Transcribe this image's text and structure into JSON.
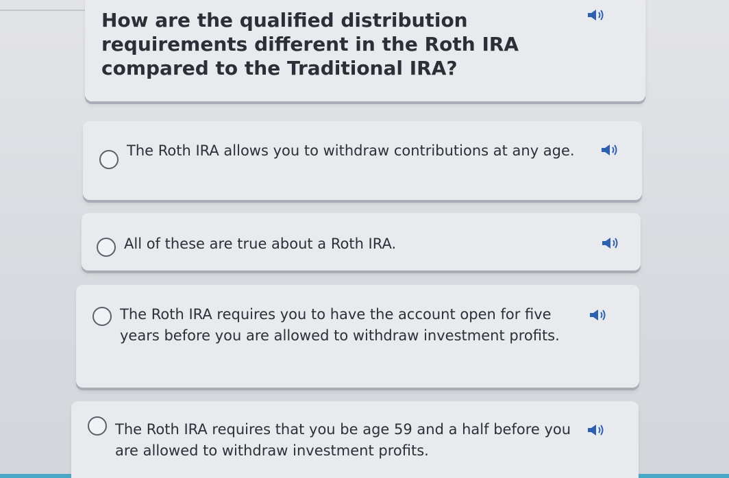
{
  "question": {
    "text": "How are the qualified distribution requirements different in the Roth IRA compared to the Traditional IRA?",
    "audio_icon": "speaker-icon"
  },
  "options": [
    {
      "text": "The Roth IRA allows you to withdraw contributions at any age.",
      "selected": false
    },
    {
      "text": "All of these are true about a Roth IRA.",
      "selected": false
    },
    {
      "text": "The Roth IRA requires you to have the account open for five years before you are allowed to withdraw investment profits.",
      "selected": false
    },
    {
      "text": "The Roth IRA requires that you be age 59 and a half before you are allowed to withdraw investment profits.",
      "selected": false
    }
  ],
  "colors": {
    "speaker": "#2d5fb3",
    "accent_bar": "#4aa8c6"
  }
}
